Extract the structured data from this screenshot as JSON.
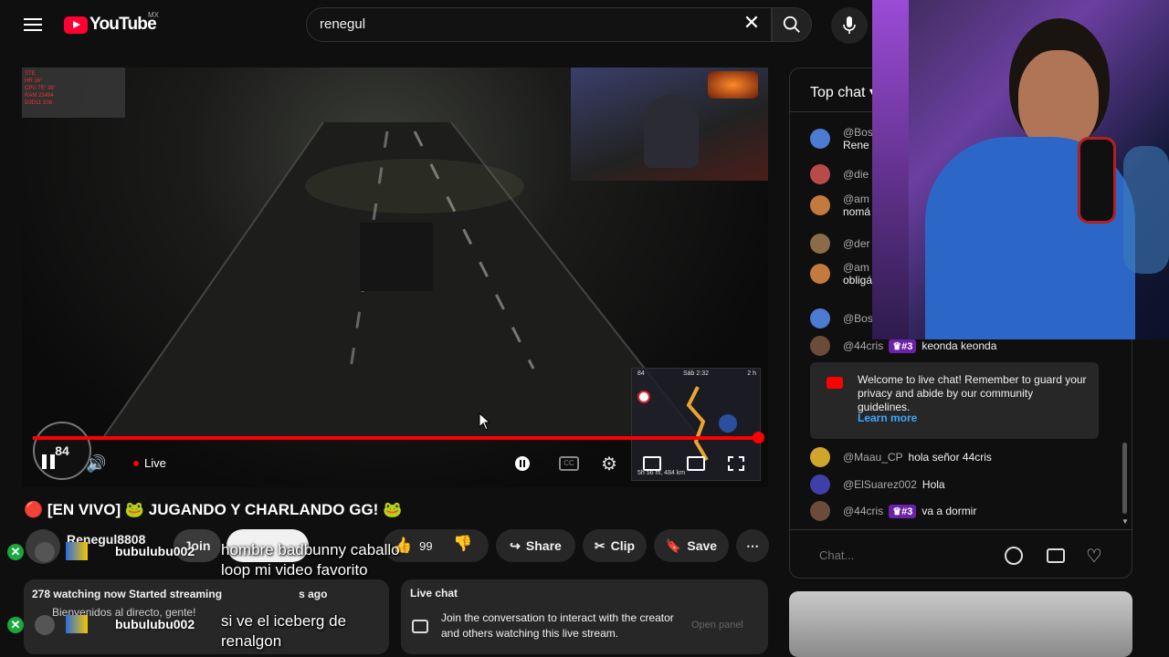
{
  "header": {
    "logo_text": "YouTube",
    "country_code": "MX",
    "search": {
      "value": "renegul",
      "placeholder": "Search"
    }
  },
  "player": {
    "hud_lines": [
      "STE",
      "HR 16°",
      "CPU 75° 39°",
      "RAM 22494",
      "D3D11 108"
    ],
    "speed": "84",
    "live_label": "Live",
    "minimap_time": "Sáb 2:32",
    "minimap_eta": "2 h",
    "minimap_distance": "5h 56 m, 484 km",
    "minimap_speed": "84",
    "progress_percent": 100
  },
  "video": {
    "title": "🔴 [EN VIVO] 🐸 JUGANDO Y CHARLANDO GG! 🐸",
    "channel": "Renegul8808",
    "join_label": "Join",
    "like_count": "99",
    "share_label": "Share",
    "clip_label": "Clip",
    "save_label": "Save",
    "description": {
      "stats": "278 watching now  Started streaming",
      "stats_suffix": "s ago",
      "line": "Bienvenidos al directo, gente!"
    },
    "livechat_card": {
      "title": "Live chat",
      "text": "Join the conversation to interact with the creator and others watching this live stream.",
      "button": "Open panel"
    }
  },
  "stream_overlays": [
    {
      "user": "bubulubu002",
      "message": "hombre badbunny caballo loop mi video favorito"
    },
    {
      "user": "bubulubu002",
      "message": "si ve el iceberg de renalgon"
    }
  ],
  "chat": {
    "header": "Top chat",
    "messages": [
      {
        "author": "@Bos",
        "text": "Rene"
      },
      {
        "author": "@die",
        "text": ""
      },
      {
        "author": "@am",
        "text": "nomá"
      },
      {
        "author": "@der",
        "text": ""
      },
      {
        "author": "@am",
        "text": "obligá"
      },
      {
        "author": "@Bos",
        "text": ""
      },
      {
        "author": "@44cris",
        "badge": "#3",
        "text": "keonda keonda"
      }
    ],
    "welcome": {
      "text": "Welcome to live chat! Remember to guard your privacy and abide by our community guidelines.",
      "link": "Learn more"
    },
    "messages_after": [
      {
        "author": "@Maau_CP",
        "text": "hola señor 44cris"
      },
      {
        "author": "@ElSuarez002",
        "text": "Hola"
      },
      {
        "author": "@44cris",
        "badge": "#3",
        "text": "va a dormir"
      }
    ],
    "input_placeholder": "Chat..."
  },
  "colors": {
    "accent": "#ff0000",
    "member_badge": "#6b21a8",
    "overlay_x": "#18a83b"
  }
}
